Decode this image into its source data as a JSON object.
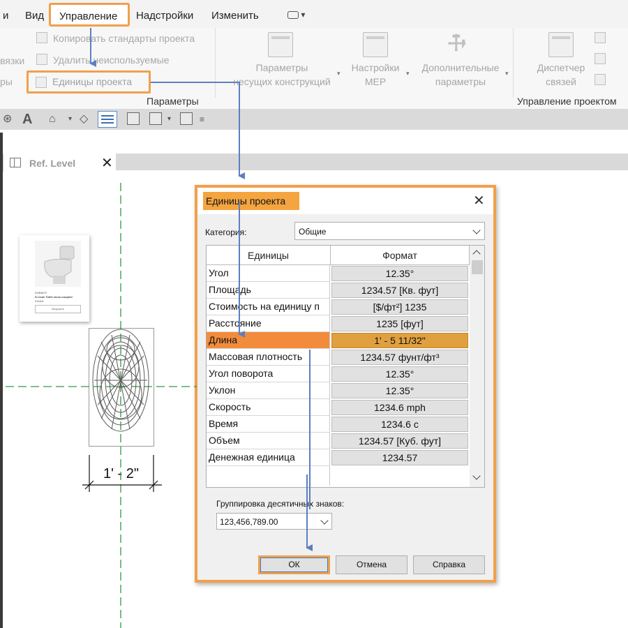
{
  "menu": {
    "items": [
      "и",
      "Вид",
      "Управление",
      "Надстройки",
      "Изменить"
    ],
    "active": "Управление"
  },
  "ribbon": {
    "small_buttons": [
      "Копировать стандарты проекта",
      "Удалить неиспользуемые",
      "Единицы проекта"
    ],
    "left_cut": [
      "вязки",
      "ры"
    ],
    "big_buttons": [
      {
        "line1": "Параметры",
        "line2": "несущих конструкций"
      },
      {
        "line1": "Настройки",
        "line2": "MEP"
      },
      {
        "line1": "Дополнительные",
        "line2": "параметры"
      },
      {
        "line1": "Диспетчер",
        "line2": "связей"
      }
    ],
    "groups": [
      "Параметры",
      "Управление проектом"
    ]
  },
  "view_tab": {
    "label": "Ref. Level",
    "close": "✕"
  },
  "thumbnail": {
    "lines": [
      "DURAVIT",
      "D-Code Toilet close-coupled",
      "211101"
    ],
    "button": "Загрузить"
  },
  "dimension": {
    "text": "1' - 2\""
  },
  "dialog": {
    "title": "Единицы проекта",
    "close": "✕",
    "category_label": "Категория:",
    "category_value": "Общие",
    "columns": [
      "Единицы",
      "Формат"
    ],
    "selected_row": "Длина",
    "rows": [
      {
        "unit": "Угол",
        "format": "12.35°"
      },
      {
        "unit": "Площадь",
        "format": "1234.57 [Кв. фут]"
      },
      {
        "unit": "Стоимость на единицу п",
        "format": "[$/фт²] 1235"
      },
      {
        "unit": "Расстояние",
        "format": "1235 [фут]"
      },
      {
        "unit": "Длина",
        "format": "1' - 5 11/32\""
      },
      {
        "unit": "Массовая плотность",
        "format": "1234.57 фунт/фт³"
      },
      {
        "unit": "Угол поворота",
        "format": "12.35°"
      },
      {
        "unit": "Уклон",
        "format": "12.35°"
      },
      {
        "unit": "Скорость",
        "format": "1234.6 mph"
      },
      {
        "unit": "Время",
        "format": "1234.6 с"
      },
      {
        "unit": "Объем",
        "format": "1234.57 [Куб. фут]"
      },
      {
        "unit": "Денежная единица",
        "format": "1234.57"
      }
    ],
    "grouping_label": "Группировка десятичных знаков:",
    "grouping_value": "123,456,789.00",
    "buttons": {
      "ok": "ОК",
      "cancel": "Отмена",
      "help": "Справка"
    }
  },
  "colors": {
    "highlight": "#f0a04b",
    "arrow": "#5b7fc0",
    "selected_row": "#f28c3c"
  }
}
